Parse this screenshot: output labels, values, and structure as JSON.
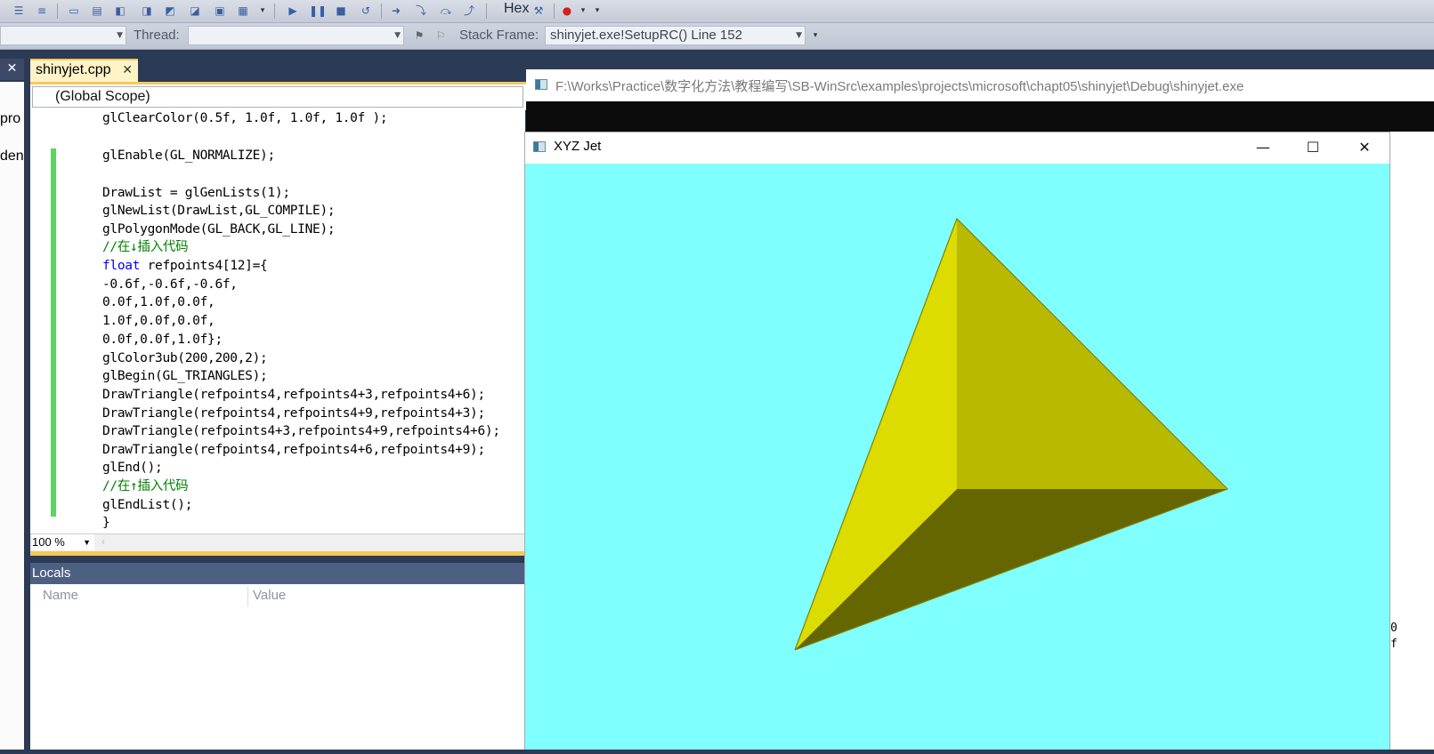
{
  "toolbar": {
    "hex_label": "Hex"
  },
  "debug_bar": {
    "thread_label": "Thread:",
    "thread_value": "",
    "stack_frame_label": "Stack Frame:",
    "stack_frame_value": "shinyjet.exe!SetupRC()  Line 152"
  },
  "left_panel": {
    "close_glyph": "✕",
    "fragments": [
      "pro",
      "den"
    ]
  },
  "editor": {
    "tab_label": "shinyjet.cpp",
    "tab_close": "✕",
    "scope": "(Global Scope)",
    "zoom": "100 %",
    "lines": [
      "glClearColor(0.5f, 1.0f, 1.0f, 1.0f );",
      "",
      "glEnable(GL_NORMALIZE);",
      "",
      "DrawList = glGenLists(1);",
      "glNewList(DrawList,GL_COMPILE);",
      "glPolygonMode(GL_BACK,GL_LINE);",
      "//在↓插入代码",
      "refpoints4[12]={",
      "-0.6f,-0.6f,-0.6f,",
      "0.0f,1.0f,0.0f,",
      "1.0f,0.0f,0.0f,",
      "0.0f,0.0f,1.0f};",
      "glColor3ub(200,200,2);",
      "glBegin(GL_TRIANGLES);",
      "DrawTriangle(refpoints4,refpoints4+3,refpoints4+6);",
      "DrawTriangle(refpoints4,refpoints4+9,refpoints4+3);",
      "DrawTriangle(refpoints4+3,refpoints4+9,refpoints4+6);",
      "DrawTriangle(refpoints4,refpoints4+6,refpoints4+9);",
      "glEnd();",
      "//在↑插入代码",
      "glEndList();",
      "}"
    ],
    "keyword_float": "float"
  },
  "locals": {
    "title": "Locals",
    "col_name": "Name",
    "col_value": "Value"
  },
  "console": {
    "title": "F:\\Works\\Practice\\数字化方法\\教程编写\\SB-WinSrc\\examples\\projects\\microsoft\\chapt05\\shinyjet\\Debug\\shinyjet.exe"
  },
  "jet_window": {
    "title": "XYZ Jet",
    "minimize": "—",
    "maximize": "☐",
    "close": "✕",
    "background_color": "#80ffff",
    "faces": {
      "left_face": "#dcdc00",
      "right_face": "#b9b900",
      "bottom_face": "#666600",
      "edge": "#808000"
    }
  },
  "right_edge_chars": [
    "0",
    "f"
  ]
}
